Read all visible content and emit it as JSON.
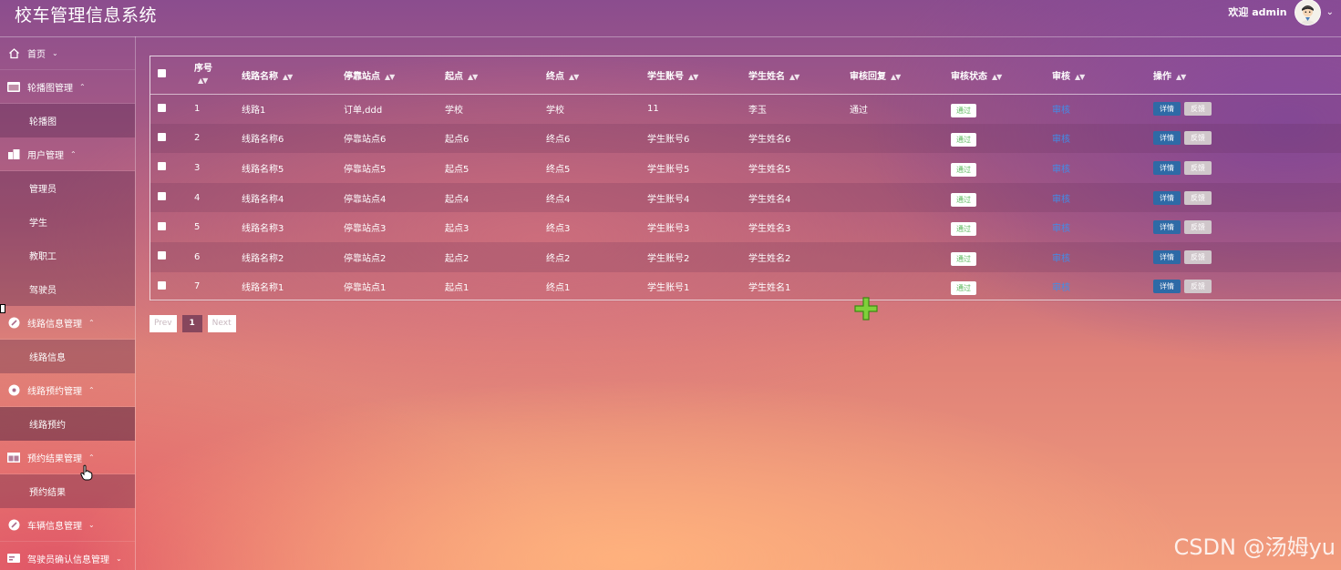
{
  "app": {
    "title": "校车管理信息系统"
  },
  "user": {
    "welcome": "欢迎 admin",
    "avatar_icon": "person-avatar-icon"
  },
  "sidebar": {
    "home": {
      "label": "首页"
    },
    "groups": [
      {
        "label": "轮播图管理",
        "icon": "image-icon",
        "expanded": true,
        "items": [
          "轮播图"
        ]
      },
      {
        "label": "用户管理",
        "icon": "users-icon",
        "expanded": true,
        "items": [
          "管理员",
          "学生",
          "教职工",
          "驾驶员"
        ]
      },
      {
        "label": "线路信息管理",
        "icon": "route-icon",
        "expanded": true,
        "items": [
          "线路信息"
        ]
      },
      {
        "label": "线路预约管理",
        "icon": "booking-icon",
        "expanded": true,
        "items": [
          "线路预约"
        ]
      },
      {
        "label": "预约结果管理",
        "icon": "window-icon",
        "expanded": true,
        "items": [
          "预约结果"
        ]
      },
      {
        "label": "车辆信息管理",
        "icon": "car-icon",
        "expanded": false,
        "items": []
      },
      {
        "label": "驾驶员确认信息管理",
        "icon": "card-icon",
        "expanded": false,
        "items": []
      }
    ]
  },
  "table": {
    "headers": [
      "序号",
      "线路名称",
      "停靠站点",
      "起点",
      "终点",
      "学生账号",
      "学生姓名",
      "审核回复",
      "审核状态",
      "审核",
      "操作"
    ],
    "rows": [
      {
        "no": "1",
        "route": "线路1",
        "stops": "订单,ddd",
        "start": "学校",
        "end": "学校",
        "account": "11",
        "name": "李玉",
        "reply": "通过",
        "status": "通过"
      },
      {
        "no": "2",
        "route": "线路名称6",
        "stops": "停靠站点6",
        "start": "起点6",
        "end": "终点6",
        "account": "学生账号6",
        "name": "学生姓名6",
        "reply": "",
        "status": "通过"
      },
      {
        "no": "3",
        "route": "线路名称5",
        "stops": "停靠站点5",
        "start": "起点5",
        "end": "终点5",
        "account": "学生账号5",
        "name": "学生姓名5",
        "reply": "",
        "status": "通过"
      },
      {
        "no": "4",
        "route": "线路名称4",
        "stops": "停靠站点4",
        "start": "起点4",
        "end": "终点4",
        "account": "学生账号4",
        "name": "学生姓名4",
        "reply": "",
        "status": "通过"
      },
      {
        "no": "5",
        "route": "线路名称3",
        "stops": "停靠站点3",
        "start": "起点3",
        "end": "终点3",
        "account": "学生账号3",
        "name": "学生姓名3",
        "reply": "",
        "status": "通过"
      },
      {
        "no": "6",
        "route": "线路名称2",
        "stops": "停靠站点2",
        "start": "起点2",
        "end": "终点2",
        "account": "学生账号2",
        "name": "学生姓名2",
        "reply": "",
        "status": "通过"
      },
      {
        "no": "7",
        "route": "线路名称1",
        "stops": "停靠站点1",
        "start": "起点1",
        "end": "终点1",
        "account": "学生账号1",
        "name": "学生姓名1",
        "reply": "",
        "status": "通过"
      }
    ],
    "audit_label": "审核",
    "detail_label": "详情",
    "feedback_label": "反馈"
  },
  "pager": {
    "prev": "Prev",
    "current": "1",
    "next": "Next"
  },
  "watermark": "CSDN @汤姆yu",
  "colors": {
    "link": "#3f8eea",
    "status_text": "#5cb85c",
    "detail_btn": "#2e6aa6"
  }
}
